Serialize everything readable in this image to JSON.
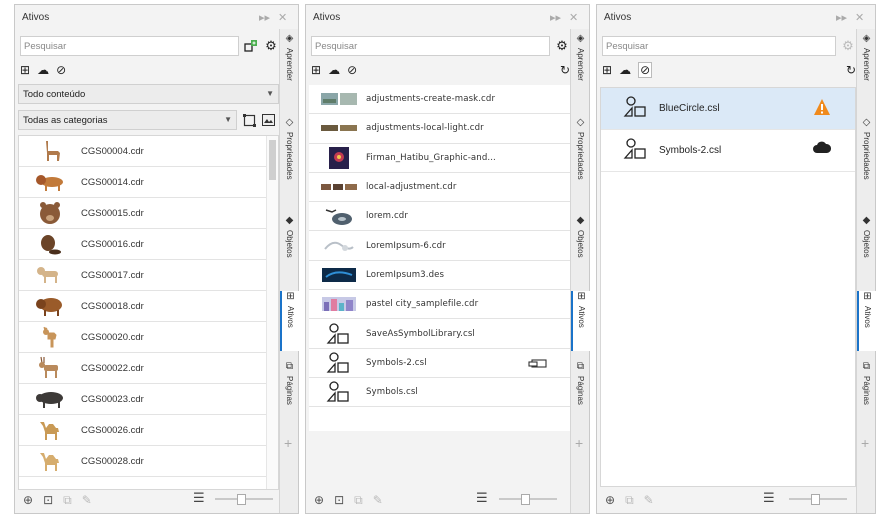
{
  "panels": [
    {
      "title": "Ativos",
      "search_placeholder": "Pesquisar",
      "filter_dropdown": "Todo conteúdo",
      "category_dropdown": "Todas as categorias",
      "items": [
        {
          "name": "CGS00004.cdr",
          "icon": "llama-icon"
        },
        {
          "name": "CGS00014.cdr",
          "icon": "lion-icon"
        },
        {
          "name": "CGS00015.cdr",
          "icon": "bear-icon"
        },
        {
          "name": "CGS00016.cdr",
          "icon": "beaver-icon"
        },
        {
          "name": "CGS00017.cdr",
          "icon": "dog-icon"
        },
        {
          "name": "CGS00018.cdr",
          "icon": "bison-icon"
        },
        {
          "name": "CGS00020.cdr",
          "icon": "deer-icon"
        },
        {
          "name": "CGS00022.cdr",
          "icon": "antelope-icon"
        },
        {
          "name": "CGS00023.cdr",
          "icon": "buffalo-icon"
        },
        {
          "name": "CGS00026.cdr",
          "icon": "camel-icon"
        },
        {
          "name": "CGS00028.cdr",
          "icon": "camel-icon"
        }
      ]
    },
    {
      "title": "Ativos",
      "search_placeholder": "Pesquisar",
      "items": [
        {
          "name": "adjustments-create-mask.cdr",
          "icon": "image-thumbnail-icon"
        },
        {
          "name": "adjustments-local-light.cdr",
          "icon": "image-thumbnail-icon"
        },
        {
          "name": "Firman_Hatibu_Graphic-and...",
          "icon": "image-thumbnail-icon"
        },
        {
          "name": "local-adjustment.cdr",
          "icon": "image-thumbnail-icon"
        },
        {
          "name": "lorem.cdr",
          "icon": "image-thumbnail-icon"
        },
        {
          "name": "LoremIpsum-6.cdr",
          "icon": "image-thumbnail-icon"
        },
        {
          "name": "LoremIpsum3.des",
          "icon": "image-thumbnail-icon"
        },
        {
          "name": "pastel city_samplefile.cdr",
          "icon": "image-thumbnail-icon"
        },
        {
          "name": "SaveAsSymbolLibrary.csl",
          "icon": "symbol-library-icon"
        },
        {
          "name": "Symbols-2.csl",
          "icon": "symbol-library-icon"
        },
        {
          "name": "Symbols.csl",
          "icon": "symbol-library-icon"
        }
      ]
    },
    {
      "title": "Ativos",
      "search_placeholder": "Pesquisar",
      "items": [
        {
          "name": "BlueCircle.csl",
          "icon": "symbol-library-icon",
          "status": "warning-icon"
        },
        {
          "name": "Symbols-2.csl",
          "icon": "symbol-library-icon",
          "status": "cloud-icon"
        }
      ]
    }
  ],
  "docker_tabs": {
    "aprender": "Aprender",
    "propriedades": "Propriedades",
    "objetos": "Objetos",
    "ativos": "Ativos",
    "paginas": "Páginas"
  },
  "colors": {
    "accent": "#1a73c9",
    "warning": "#f08a1c",
    "selected_row": "#dbe9f7"
  }
}
